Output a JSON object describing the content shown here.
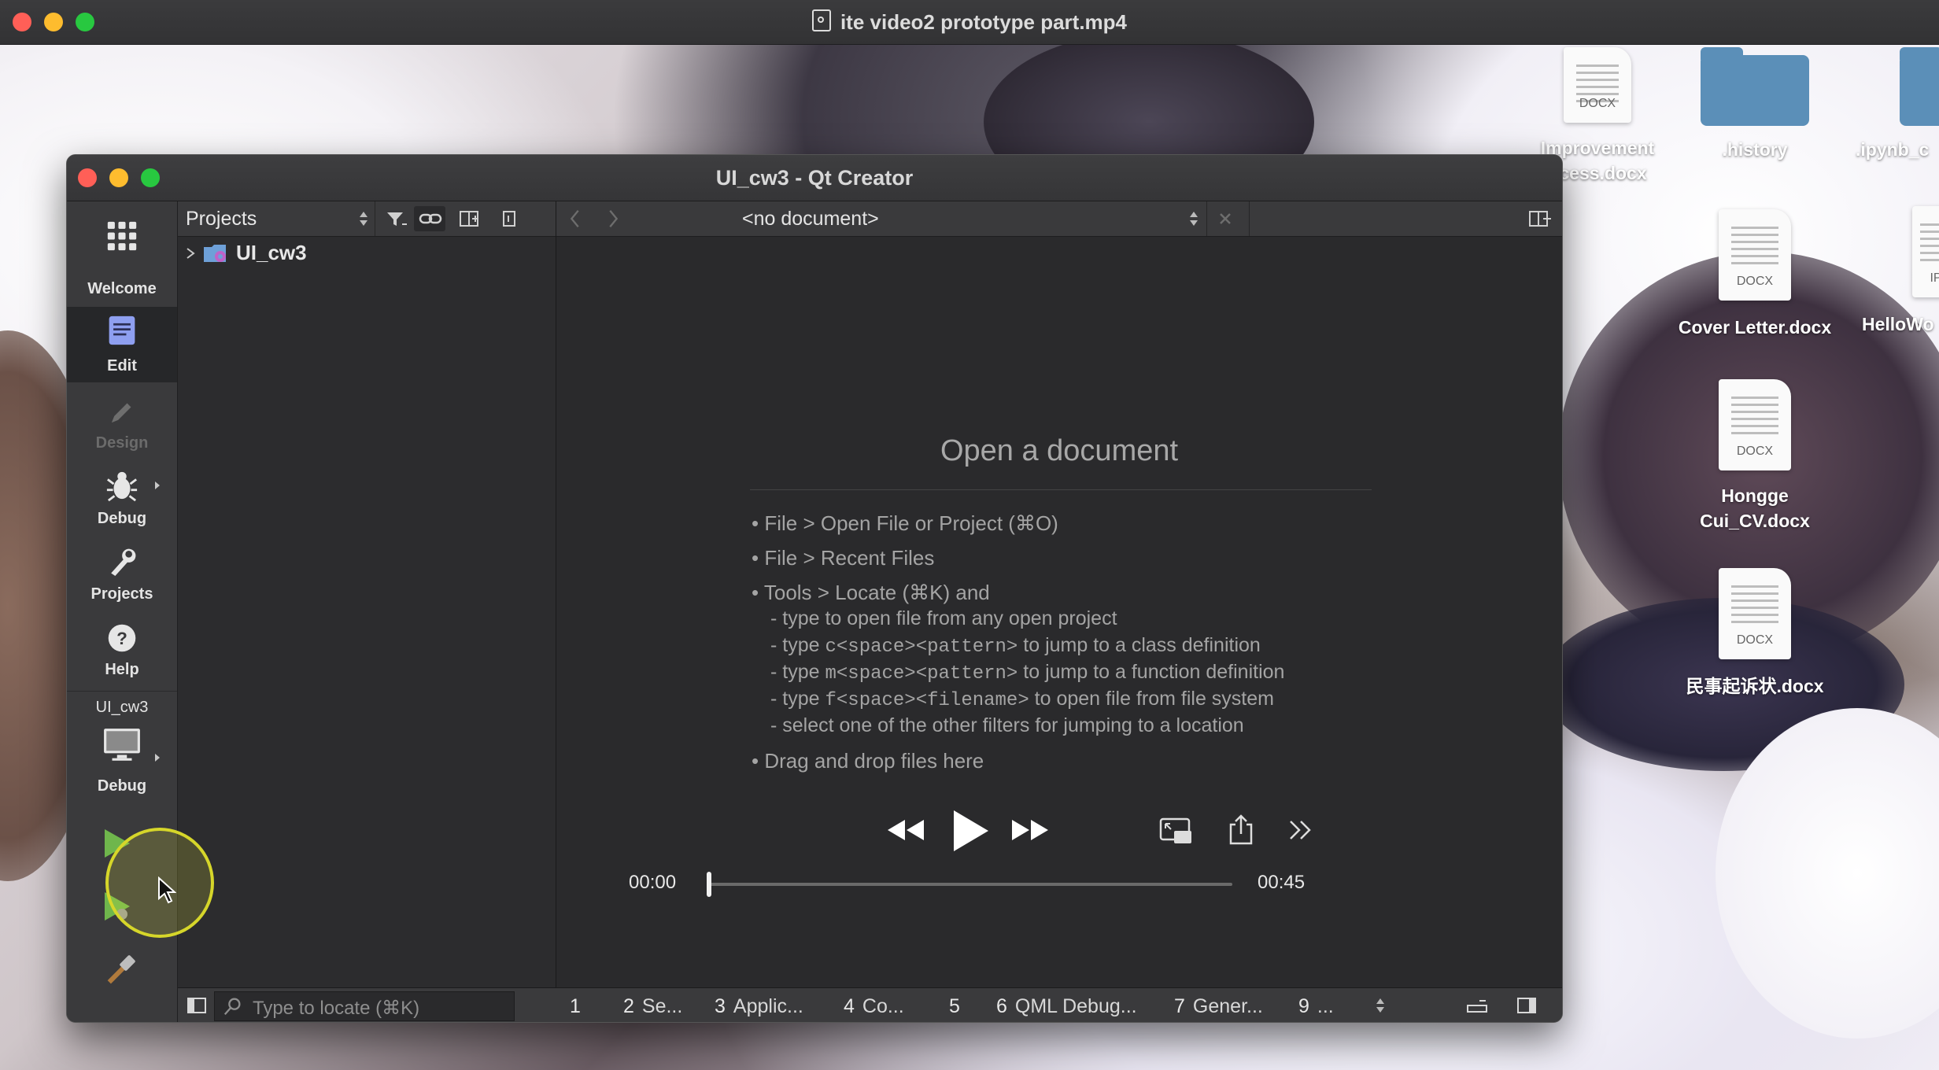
{
  "player_window": {
    "title": "ite video2 prototype part.mp4"
  },
  "desktop": {
    "icons": [
      {
        "label_line1": "Improvement",
        "label_line2": "ocess.docx",
        "kind": "docx"
      },
      {
        "label_line1": ".history",
        "label_line2": "",
        "kind": "folder"
      },
      {
        "label_line1": ".ipynb_c",
        "label_line2": "",
        "kind": "folder"
      },
      {
        "label_line1": "Cover Letter.docx",
        "label_line2": "",
        "kind": "docx"
      },
      {
        "label_line1": "HelloWo",
        "label_line2": "",
        "kind": "pdf"
      },
      {
        "label_line1": "Hongge",
        "label_line2": "Cui_CV.docx",
        "kind": "docx"
      },
      {
        "label_line1": "民事起诉状.docx",
        "label_line2": "",
        "kind": "docx"
      }
    ],
    "doc_tag": "DOCX",
    "pdf_tag": "IP"
  },
  "qt": {
    "title": "UI_cw3 - Qt Creator",
    "modes": [
      {
        "label": "Welcome",
        "icon": "grid-icon",
        "state": "normal"
      },
      {
        "label": "Edit",
        "icon": "document-icon",
        "state": "active"
      },
      {
        "label": "Design",
        "icon": "pencil-icon",
        "state": "disabled"
      },
      {
        "label": "Debug",
        "icon": "bug-icon",
        "state": "normal"
      },
      {
        "label": "Projects",
        "icon": "wrench-icon",
        "state": "normal"
      },
      {
        "label": "Help",
        "icon": "help-icon",
        "state": "normal"
      }
    ],
    "kit": {
      "project": "UI_cw3",
      "config": "Debug"
    },
    "projects_pane": {
      "selector": "Projects",
      "tree": [
        {
          "label": "UI_cw3",
          "expanded": false
        }
      ]
    },
    "editor": {
      "document_combo": "<no document>",
      "welcome_title": "Open a document",
      "items": [
        "• File > Open File or Project (⌘O)",
        "• File > Recent Files",
        "• Tools > Locate (⌘K) and"
      ],
      "sub_items": [
        {
          "pre": "- type to open file from any open project",
          "code": "",
          "post": ""
        },
        {
          "pre": "- type ",
          "code": "c<space><pattern>",
          "post": " to jump to a class definition"
        },
        {
          "pre": "- type ",
          "code": "m<space><pattern>",
          "post": " to jump to a function definition"
        },
        {
          "pre": "- type ",
          "code": "f<space><filename>",
          "post": " to open file from file system"
        },
        {
          "pre": "- select one of the other filters for jumping to a location",
          "code": "",
          "post": ""
        }
      ],
      "last_item": "• Drag and drop files here"
    },
    "statusbar": {
      "locator_placeholder": "Type to locate (⌘K)",
      "panes": [
        {
          "num": "1",
          "label": ""
        },
        {
          "num": "2",
          "label": "Se..."
        },
        {
          "num": "3",
          "label": "Applic..."
        },
        {
          "num": "4",
          "label": "Co..."
        },
        {
          "num": "5",
          "label": ""
        },
        {
          "num": "6",
          "label": "QML Debug..."
        },
        {
          "num": "7",
          "label": "Gener..."
        },
        {
          "num": "9",
          "label": "..."
        }
      ]
    }
  },
  "video": {
    "current_time": "00:00",
    "duration": "00:45",
    "progress": 0.0
  },
  "colors": {
    "cursor_highlight": "#d6d62a",
    "close": "#ff5f57",
    "minimize": "#febc2e",
    "zoom": "#28c840"
  }
}
